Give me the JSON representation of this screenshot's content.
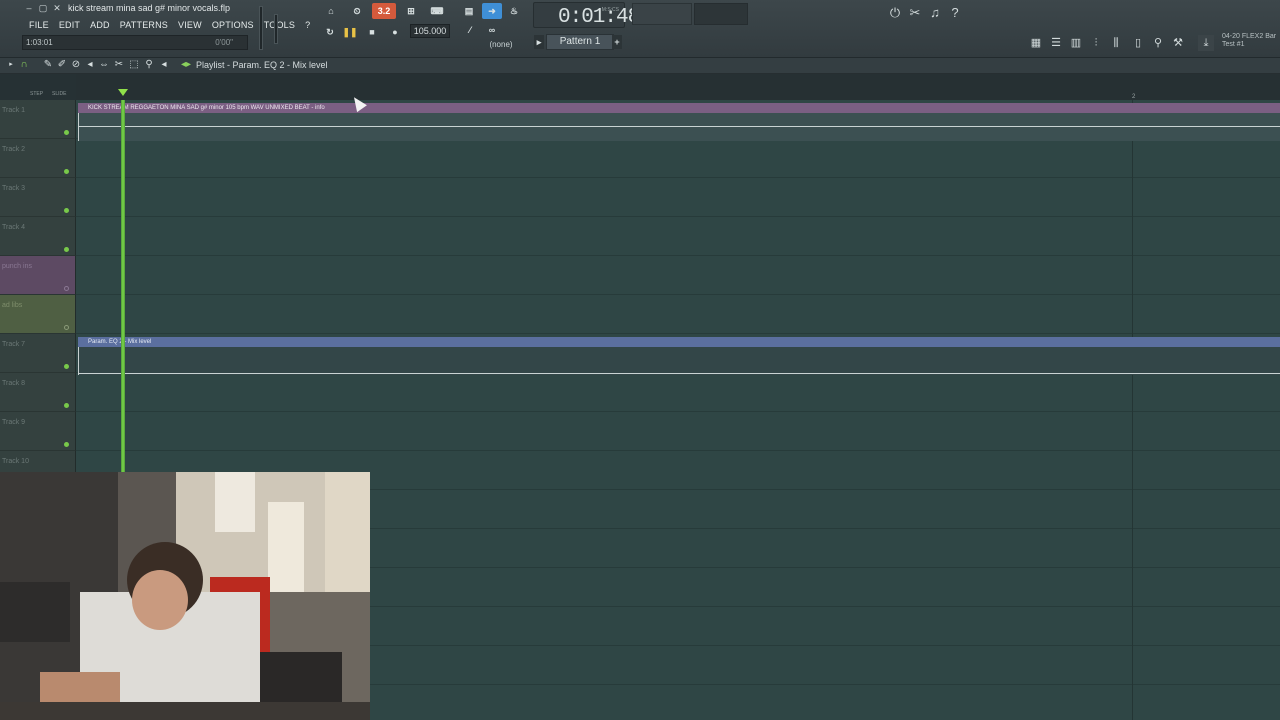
{
  "window": {
    "title": "kick stream mina sad g# minor vocals.flp"
  },
  "menu": [
    "FILE",
    "EDIT",
    "ADD",
    "PATTERNS",
    "VIEW",
    "OPTIONS",
    "TOOLS",
    "?"
  ],
  "hint_bar": {
    "left": "1:03:01",
    "right": "0'00\""
  },
  "transport": {
    "tempo": "105.000",
    "time": "0:01:48",
    "time_unit": "M:S:CS",
    "pattern": "Pattern 1",
    "channel_none": "(none)",
    "song_mode_badge": "3.2"
  },
  "news": {
    "line1": "04-20  FLEX2 Bar",
    "line2": "Test #1"
  },
  "playlist": {
    "title": "Playlist - Param. EQ 2 - Mix level",
    "ruler_bar": "2",
    "snap_labels": [
      "STEP",
      "SLIDE"
    ]
  },
  "tracks": [
    {
      "name": "Track 1"
    },
    {
      "name": "Track 2"
    },
    {
      "name": "Track 3"
    },
    {
      "name": "Track 4"
    },
    {
      "name": "punch ins"
    },
    {
      "name": "ad libs"
    },
    {
      "name": "Track 7"
    },
    {
      "name": "Track 8"
    },
    {
      "name": "Track 9"
    },
    {
      "name": "Track 10"
    }
  ],
  "clips": {
    "audio": "KICK STREAM REGGAETON MINA SAD g# minor 105 bpm WAV UNMIXED BEAT - info",
    "automation": "Param. EQ 2 - Mix level"
  },
  "colors": {
    "playlist_bg": "#2f4645",
    "audio_clip": "#7b5f83",
    "automation_clip": "#5b6f9f",
    "playhead": "#7bd84c",
    "punch_ins_track": "#5d4a63",
    "ad_libs_track": "#4f5f43"
  }
}
